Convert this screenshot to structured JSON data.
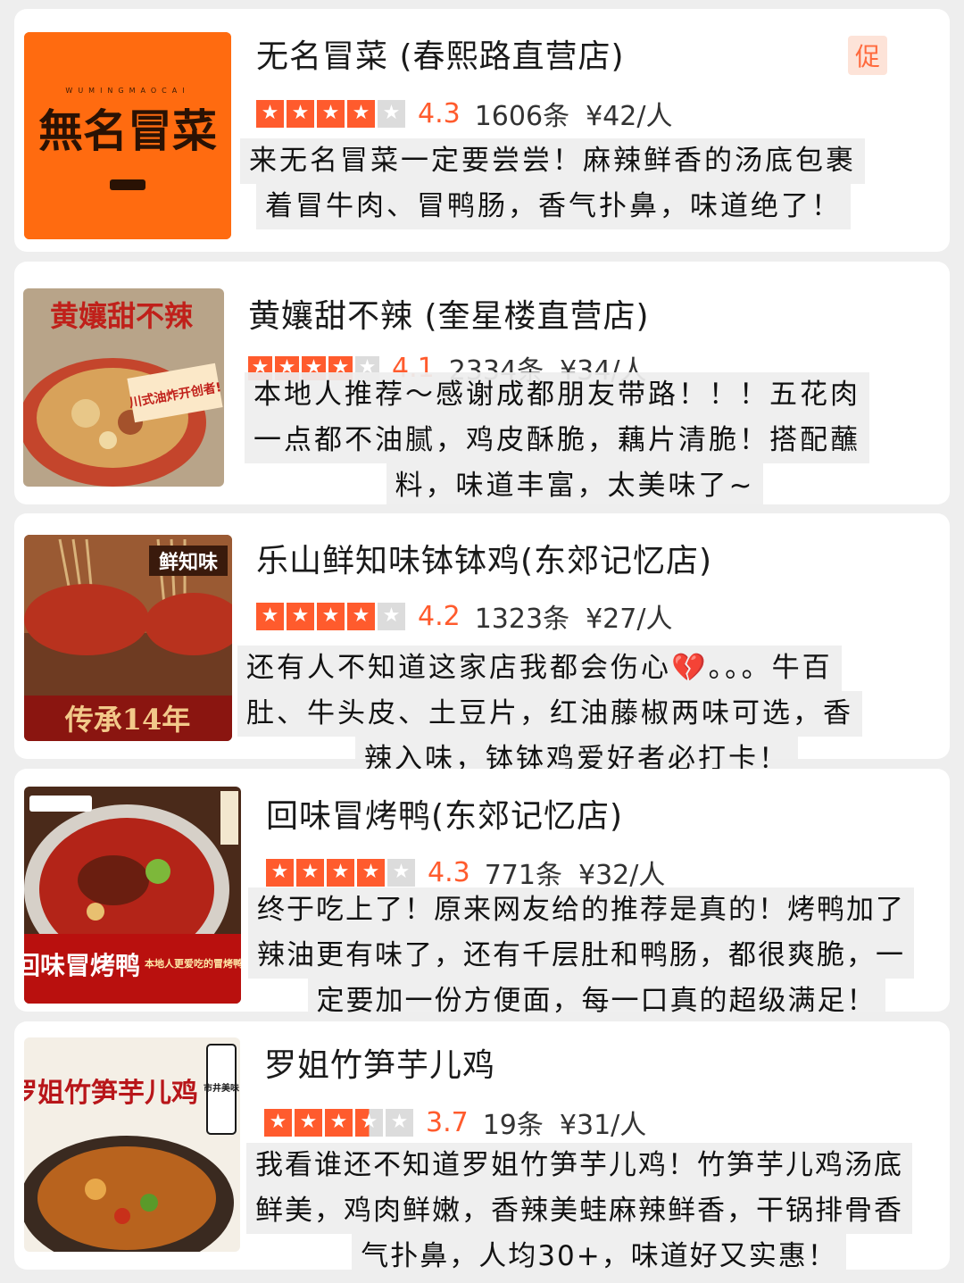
{
  "colors": {
    "accent": "#ff5b2d",
    "star_empty": "#dcdcdc",
    "promo_bg": "#fde3d8"
  },
  "icons": {
    "star": "star-icon",
    "broken_heart": "broken-heart-icon"
  },
  "shops": [
    {
      "name": "无名冒菜 (春熙路直营店)",
      "rating": 4.3,
      "score": "4.3",
      "count": "1606条",
      "price": "¥42/人",
      "badge": "促",
      "thumb_text": "無名冒菜",
      "thumb_sub": "WUMINGMAOCAI",
      "review": [
        "来无名冒菜一定要尝尝！麻辣鲜香的汤底包裹",
        "着冒牛肉、冒鸭肠，香气扑鼻，味道绝了！"
      ]
    },
    {
      "name": "黄孃甜不辣 (奎星楼直营店)",
      "rating": 4.1,
      "score": "4.1",
      "count": "2334条",
      "price": "¥34/人",
      "thumb_text": "黄孃甜不辣",
      "thumb_sub": "川式油炸开创者!",
      "review": [
        "本地人推荐～感谢成都朋友带路！！！五花肉",
        "一点都不油腻，鸡皮酥脆，藕片清脆！搭配蘸",
        "料，味道丰富，太美味了~"
      ]
    },
    {
      "name": "乐山鲜知味钵钵鸡(东郊记忆店)",
      "rating": 4.2,
      "score": "4.2",
      "count": "1323条",
      "price": "¥27/人",
      "thumb_text": "鲜知味",
      "thumb_sub": "传承14年",
      "review": [
        "还有人不知道这家店我都会伤心",
        "。。。牛百",
        "肚、牛头皮、土豆片，红油藤椒两味可选，香",
        "辣入味，钵钵鸡爱好者必打卡！"
      ]
    },
    {
      "name": "回味冒烤鸭(东郊记忆店)",
      "rating": 4.3,
      "score": "4.3",
      "count": "771条",
      "price": "¥32/人",
      "thumb_text": "回味冒烤鸭",
      "thumb_sub": "本地人更爱吃的冒烤鸭",
      "review": [
        "终于吃上了！原来网友给的推荐是真的！烤鸭加了",
        "辣油更有味了，还有千层肚和鸭肠，都很爽脆，一",
        "定要加一份方便面，每一口真的超级满足！"
      ]
    },
    {
      "name": "罗姐竹笋芋儿鸡",
      "rating": 3.7,
      "score": "3.7",
      "count": "19条",
      "price": "¥31/人",
      "thumb_text": "罗姐竹笋芋儿鸡",
      "thumb_sub": "市井美味",
      "review": [
        "我看谁还不知道罗姐竹笋芋儿鸡！竹笋芋儿鸡汤底",
        "鲜美，鸡肉鲜嫩，香辣美蛙麻辣鲜香，干锅排骨香",
        "气扑鼻，人均30+，味道好又实惠！"
      ]
    }
  ]
}
